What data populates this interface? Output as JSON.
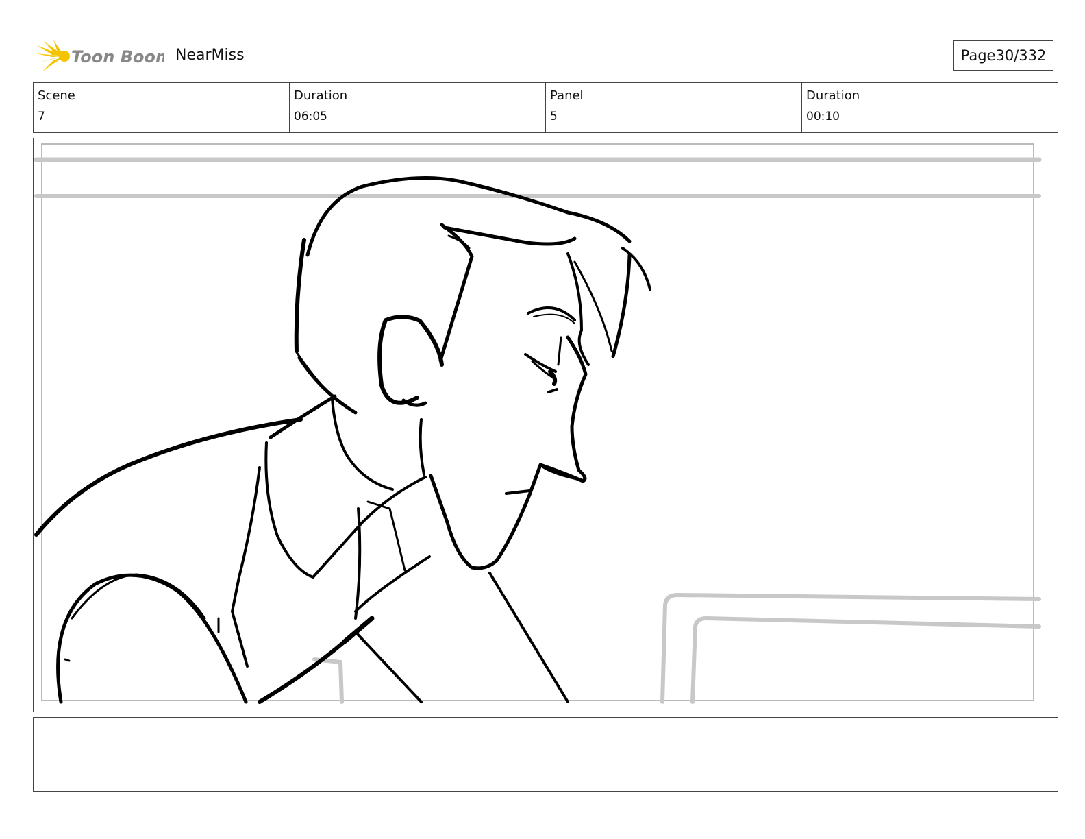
{
  "header": {
    "logo_text": "Toon Boom",
    "project_title": "NearMiss",
    "page_label": "Page",
    "page_number": "30/332"
  },
  "info": {
    "scene_label": "Scene",
    "scene_value": "7",
    "scene_duration_label": "Duration",
    "scene_duration_value": "06:05",
    "panel_label": "Panel",
    "panel_value": "5",
    "panel_duration_label": "Duration",
    "panel_duration_value": "00:10"
  },
  "colors": {
    "logo_yellow": "#f5c400",
    "logo_gray": "#888888",
    "border": "#444444",
    "sketch_line": "#000000",
    "background_line": "#c8c8c8"
  },
  "notes": {
    "text": ""
  }
}
